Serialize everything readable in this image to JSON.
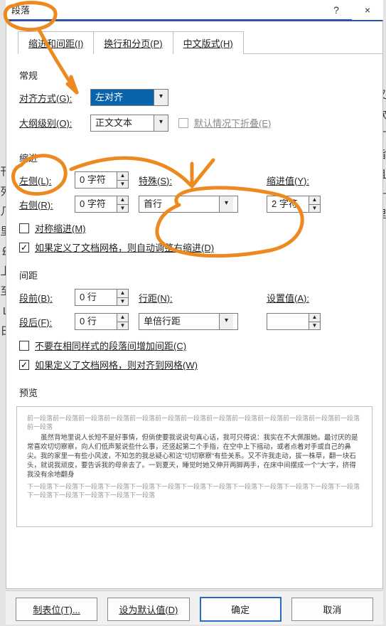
{
  "window": {
    "title": "段落",
    "question": "?",
    "close": "×"
  },
  "backtext_left": "《寸刊列几里￡型上至L日",
  "backtext_right": "又款才旨且十里",
  "tabs": {
    "indent": "缩进和间距(I)",
    "page": "换行和分页(P)",
    "cjk": "中文版式(H)"
  },
  "general": {
    "title": "常规",
    "align_label": "对齐方式(G):",
    "align_value": "左对齐",
    "outline_label": "大纲级别(O):",
    "outline_value": "正文文本",
    "collapse_label": "默认情况下折叠(E)"
  },
  "indent": {
    "title": "缩进",
    "left_label": "左侧(L):",
    "left_value": "0 字符",
    "right_label": "右侧(R):",
    "right_value": "0 字符",
    "special_label": "特殊(S):",
    "special_value": "首行",
    "by_label": "缩进值(Y):",
    "by_value": "2 字符",
    "mirror_label": "对称缩进(M)",
    "grid_label": "如果定义了文档网格，则自动调整右缩进(D)"
  },
  "spacing": {
    "title": "间距",
    "before_label": "段前(B):",
    "before_value": "0 行",
    "after_label": "段后(F):",
    "after_value": "0 行",
    "line_label": "行距(N):",
    "line_value": "单倍行距",
    "at_label": "设置值(A):",
    "at_value": "",
    "nosame_label": "不要在相同样式的段落间增加间距(C)",
    "snap_label": "如果定义了文档网格，则对齐到网格(W)"
  },
  "preview": {
    "title": "预览",
    "filler_pre": "前一段落前一段落前一段落前一段落前一段落前一段落前一段落前一段落前一段落前一段落前一段落前一段落前一段落前一段落",
    "body": "虽然背地里说人长短不是好事情，但倘使要我说说句真心话，我可只得说：我实在不大佩服她。最讨厌的是常喜欢切切察察，向人们低声絮说些什么事，还竖起第二个手指，在空中上下摇动，或者点着对手或自己的鼻尖。我的家里一有些小风波，不知怎的我总疑心和这\"切切察察\"有些关系。又不许我走动，拔一株草，翻一块石头，就说我顽皮，要告诉我的母亲去了。一到夏天，睡觉时她又伸开两脚两手，在床中间摆成一个\"大\"字，挤得我没有余地翻身",
    "filler_post": "下一段落下一段落下一段落下一段落下一段落下一段落下一段落下一段落下一段落下一段落下一段落下一段落下一段落下一段落下一段落下一段落下一段落下一段落"
  },
  "buttons": {
    "tabs": "制表位(T)...",
    "default": "设为默认值(D)",
    "ok": "确定",
    "cancel": "取消"
  }
}
